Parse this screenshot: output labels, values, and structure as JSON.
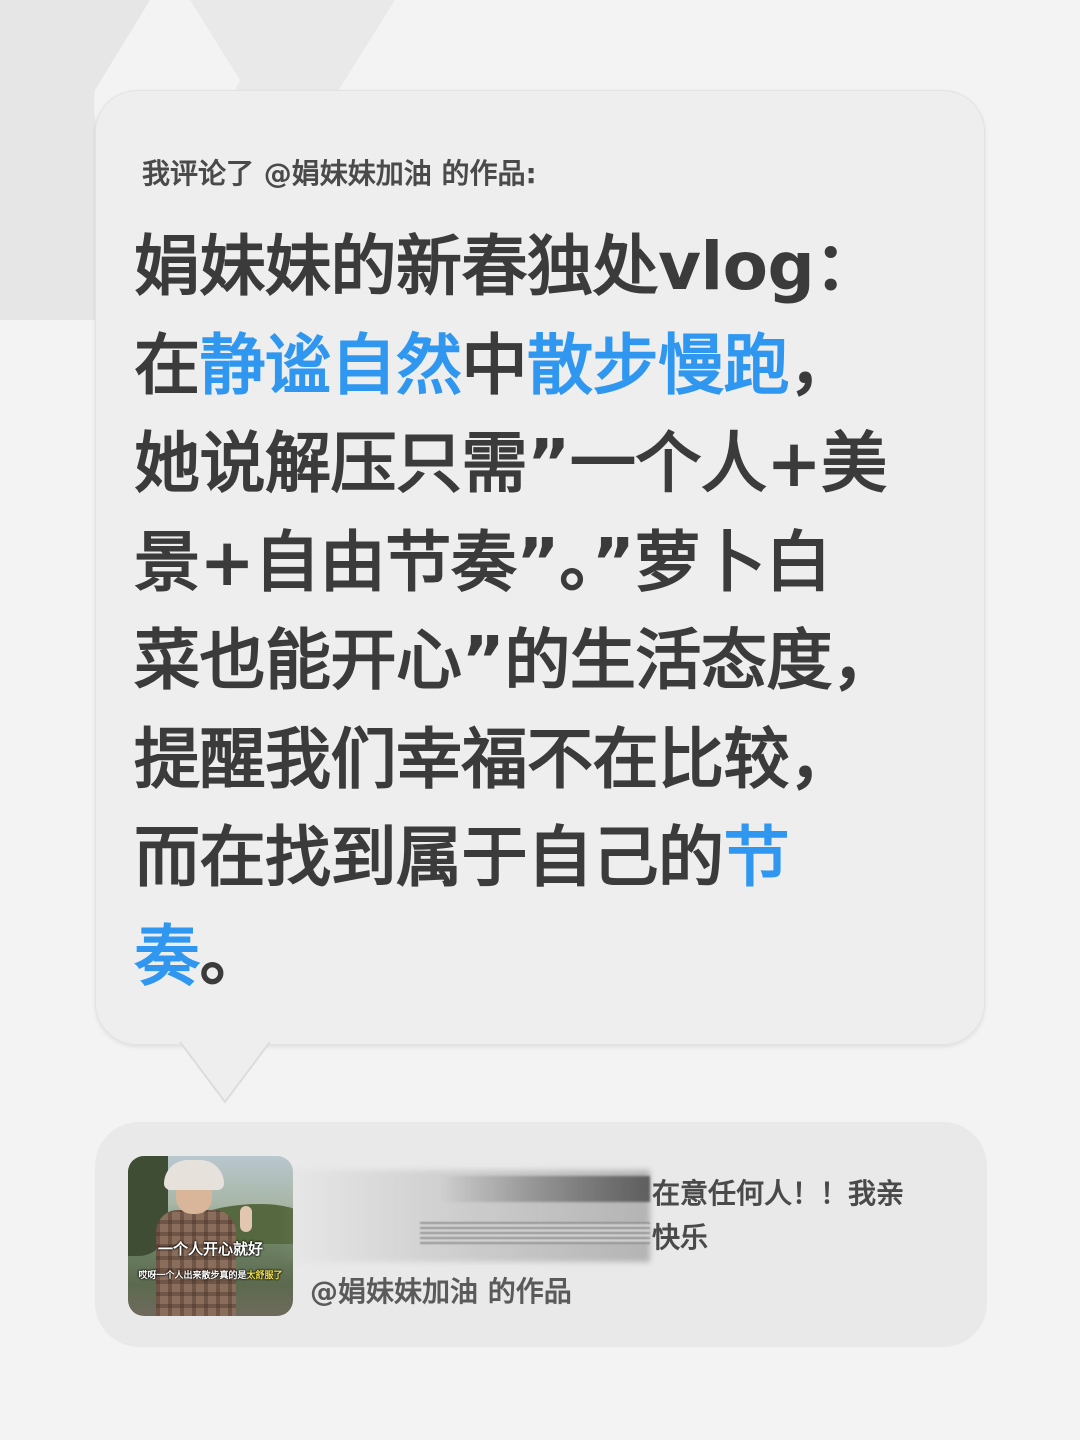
{
  "comment": {
    "header": "我评论了 @娟妹妹加油 的作品:",
    "lines": [
      [
        {
          "t": "娟妹妹的新春独处vlog：",
          "hl": false
        }
      ],
      [
        {
          "t": "在",
          "hl": false
        },
        {
          "t": "静谧自然",
          "hl": true
        },
        {
          "t": "中",
          "hl": false
        },
        {
          "t": "散步慢跑",
          "hl": true
        },
        {
          "t": "，",
          "hl": false
        }
      ],
      [
        {
          "t": "她说解压只需”一个人+美",
          "hl": false
        }
      ],
      [
        {
          "t": "景+自由节奏”。”萝卜白",
          "hl": false
        }
      ],
      [
        {
          "t": "菜也能开心”的生活态度，",
          "hl": false
        }
      ],
      [
        {
          "t": "提醒我们幸福不在比较，",
          "hl": false
        }
      ],
      [
        {
          "t": "而在找到属于自己的",
          "hl": false
        },
        {
          "t": "节",
          "hl": true
        }
      ],
      [
        {
          "t": "奏",
          "hl": true
        },
        {
          "t": "。",
          "hl": false
        }
      ]
    ]
  },
  "colors": {
    "background": "#f3f3f3",
    "bubble": "#eeeeee",
    "text": "#3b3b3b",
    "highlight": "#2f97f0",
    "card": "#e9e9e9"
  },
  "video_card": {
    "thumbnail": {
      "caption_main": "一个人开心就好",
      "caption_sub_prefix": "哎呀一个人出来散步真的是",
      "caption_sub_highlight": "太舒服了"
    },
    "snippet_lines": [
      "在意任何人！！我亲",
      "快乐"
    ],
    "author": "@娟妹妹加油 的作品"
  }
}
